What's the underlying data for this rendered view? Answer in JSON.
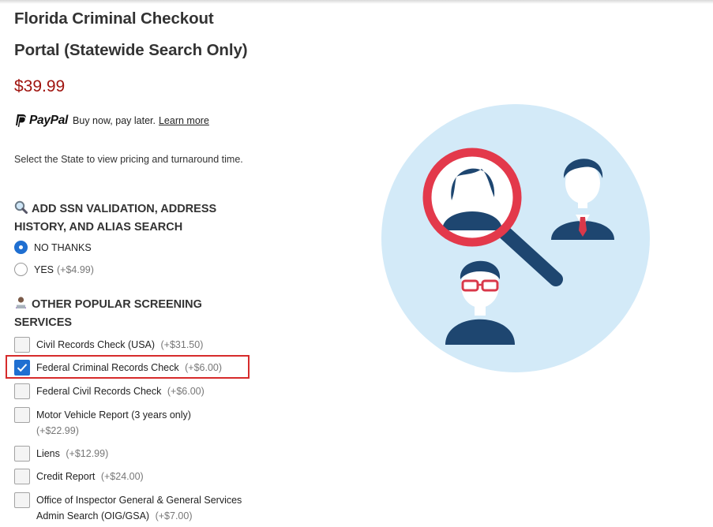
{
  "product": {
    "title_line1": "Florida Criminal Checkout",
    "title_line2": "Portal (Statewide Search Only)",
    "price": "$39.99"
  },
  "paypal": {
    "brand": "PayPal",
    "text": "Buy now, pay later.",
    "link": "Learn more"
  },
  "instructions": "Select the State to view pricing and turnaround time.",
  "ssn_section": {
    "heading": "ADD SSN VALIDATION, ADDRESS HISTORY, AND ALIAS SEARCH",
    "icon": "magnifier-emoji",
    "options": [
      {
        "label": "NO THANKS",
        "addon": "",
        "selected": true
      },
      {
        "label": "YES",
        "addon": "(+$4.99)",
        "selected": false
      }
    ]
  },
  "other_section": {
    "heading": "OTHER POPULAR SCREENING SERVICES",
    "icon": "person-laptop-emoji",
    "items": [
      {
        "label": "Civil Records Check (USA)",
        "addon": "(+$31.50)",
        "checked": false
      },
      {
        "label": "Federal Criminal Records Check",
        "addon": "(+$6.00)",
        "checked": true
      },
      {
        "label": "Federal Civil Records Check",
        "addon": "(+$6.00)",
        "checked": false
      },
      {
        "label": "Motor Vehicle Report (3 years only)",
        "addon": "(+$22.99)",
        "checked": false
      },
      {
        "label": "Liens",
        "addon": "(+$12.99)",
        "checked": false
      },
      {
        "label": "Credit Report",
        "addon": "(+$24.00)",
        "checked": false
      },
      {
        "label": "Office of Inspector General & General Services Admin Search (OIG/GSA)",
        "addon": "(+$7.00)",
        "checked": false
      }
    ]
  },
  "colors": {
    "price": "#a0140f",
    "accent": "#1f6fd1",
    "highlight": "#d62b2b",
    "illustration_bg": "#d3eaf8",
    "navy": "#1e4670"
  }
}
